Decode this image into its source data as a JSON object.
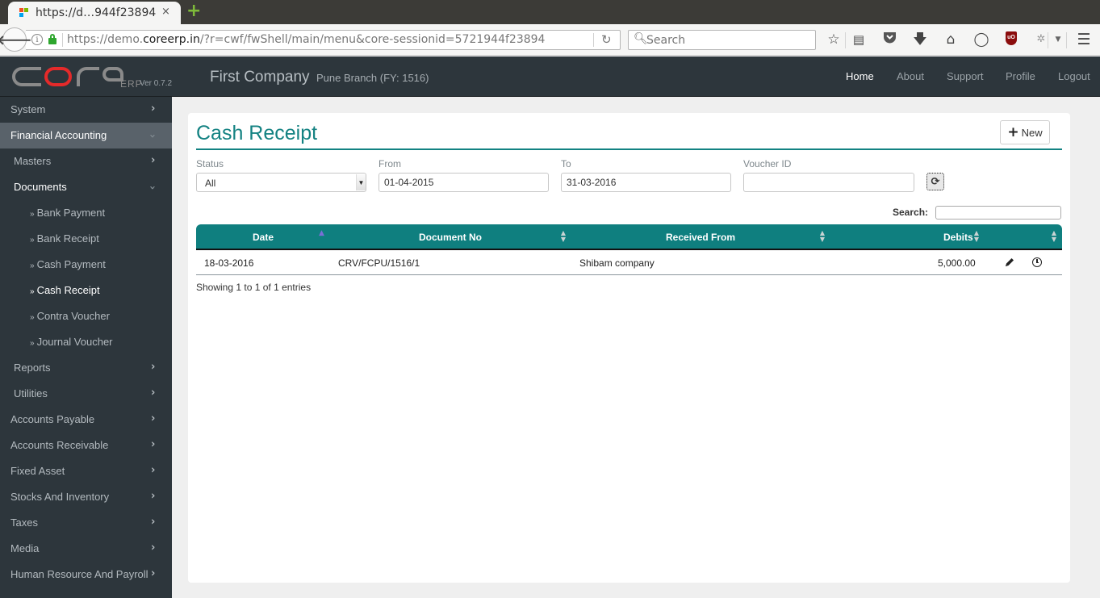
{
  "browser": {
    "tab_title": "https://d…944f23894",
    "tab_close": "×",
    "new_tab": "+",
    "url_prefix": "https://demo.",
    "url_domain": "coreerp.in",
    "url_path": "/?r=cwf/fwShell/main/menu&core-sessionid=5721944f23894",
    "search_placeholder": "Search",
    "toolbar_icons": [
      "bookmark-star-icon",
      "reading-list-icon",
      "pocket-icon",
      "download-icon",
      "home-icon",
      "chat-icon",
      "ublock-icon",
      "extension-icon",
      "menu-icon"
    ]
  },
  "app": {
    "logo_text": "core",
    "logo_suffix": "ERP",
    "version": "Ver 0.7.2",
    "company": "First Company",
    "branch": "Pune Branch (FY: 1516)",
    "nav": [
      {
        "label": "Home",
        "active": true
      },
      {
        "label": "About",
        "active": false
      },
      {
        "label": "Support",
        "active": false
      },
      {
        "label": "Profile",
        "active": false
      },
      {
        "label": "Logout",
        "active": false
      }
    ]
  },
  "sidebar": {
    "items": [
      {
        "label": "System",
        "level": 0,
        "state": "collapsed"
      },
      {
        "label": "Financial Accounting",
        "level": 0,
        "state": "expanded"
      },
      {
        "label": "Masters",
        "level": 1,
        "state": "collapsed"
      },
      {
        "label": "Documents",
        "level": 1,
        "state": "expanded"
      },
      {
        "label": "Bank Payment",
        "level": 2
      },
      {
        "label": "Bank Receipt",
        "level": 2
      },
      {
        "label": "Cash Payment",
        "level": 2
      },
      {
        "label": "Cash Receipt",
        "level": 2,
        "active": true
      },
      {
        "label": "Contra Voucher",
        "level": 2
      },
      {
        "label": "Journal Voucher",
        "level": 2
      },
      {
        "label": "Reports",
        "level": 1,
        "state": "collapsed"
      },
      {
        "label": "Utilities",
        "level": 1,
        "state": "collapsed"
      },
      {
        "label": "Accounts Payable",
        "level": 0,
        "state": "collapsed"
      },
      {
        "label": "Accounts Receivable",
        "level": 0,
        "state": "collapsed"
      },
      {
        "label": "Fixed Asset",
        "level": 0,
        "state": "collapsed"
      },
      {
        "label": "Stocks And Inventory",
        "level": 0,
        "state": "collapsed"
      },
      {
        "label": "Taxes",
        "level": 0,
        "state": "collapsed"
      },
      {
        "label": "Media",
        "level": 0,
        "state": "collapsed"
      },
      {
        "label": "Human Resource And Payroll",
        "level": 0,
        "state": "collapsed"
      }
    ],
    "sub_prefix": "»"
  },
  "main": {
    "title": "Cash Receipt",
    "new_button": "New",
    "filters": {
      "status_label": "Status",
      "status_value": "All",
      "from_label": "From",
      "from_value": "01-04-2015",
      "to_label": "To",
      "to_value": "31-03-2016",
      "voucher_label": "Voucher ID",
      "voucher_value": ""
    },
    "search_label": "Search:",
    "search_value": "",
    "table": {
      "columns": [
        "Date",
        "Document No",
        "Received From",
        "Debits",
        ""
      ],
      "sorted_column": "Date",
      "sort_direction": "asc",
      "rows": [
        {
          "date": "18-03-2016",
          "document_no": "CRV/FCPU/1516/1",
          "received_from": "Shibam company",
          "debits": "5,000.00"
        }
      ]
    },
    "info": "Showing 1 to 1 of 1 entries"
  }
}
